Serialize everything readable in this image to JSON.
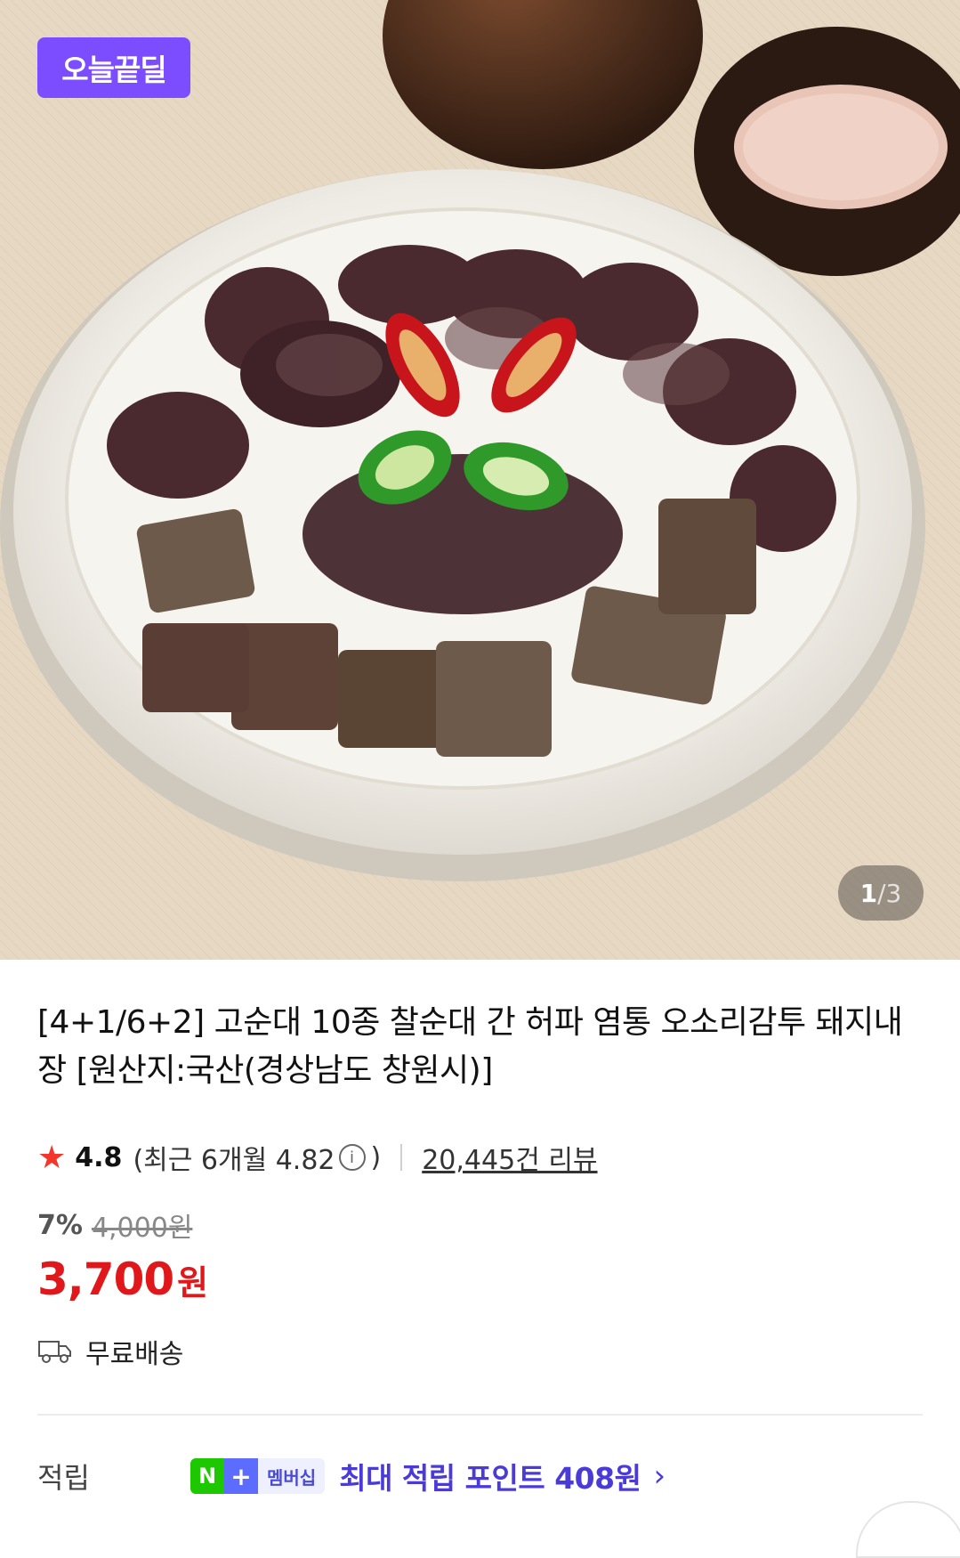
{
  "hero": {
    "badge_label": "오늘끝딜",
    "pager": {
      "current": "1",
      "separator": "/",
      "total": "3"
    }
  },
  "product": {
    "title": "[4+1/6+2] 고순대 10종 찰순대 간 허파 염통 오소리감투 돼지내장 [원산지:국산(경상남도 창원시)]",
    "rating": "4.8",
    "recent_rating": "(최근 6개월 4.82",
    "recent_rating_close": ")",
    "reviews": "20,445건 리뷰",
    "discount": "7%",
    "original_price": "4,000원",
    "price": "3,700",
    "price_unit": "원",
    "shipping": "무료배송"
  },
  "points": {
    "label": "적립",
    "badge_n": "N",
    "badge_plus": "+",
    "badge_membership": "멤버십",
    "text": "최대 적립 포인트 408원",
    "chevron": "›"
  },
  "colors": {
    "badge_purple": "#7b4dff",
    "price_red": "#e0181c",
    "star_red": "#f2362c",
    "points_purple": "#4a3bd9",
    "naver_green": "#1ec800"
  },
  "icons": [
    "star-icon",
    "info-icon",
    "truck-icon",
    "chevron-right-icon"
  ]
}
